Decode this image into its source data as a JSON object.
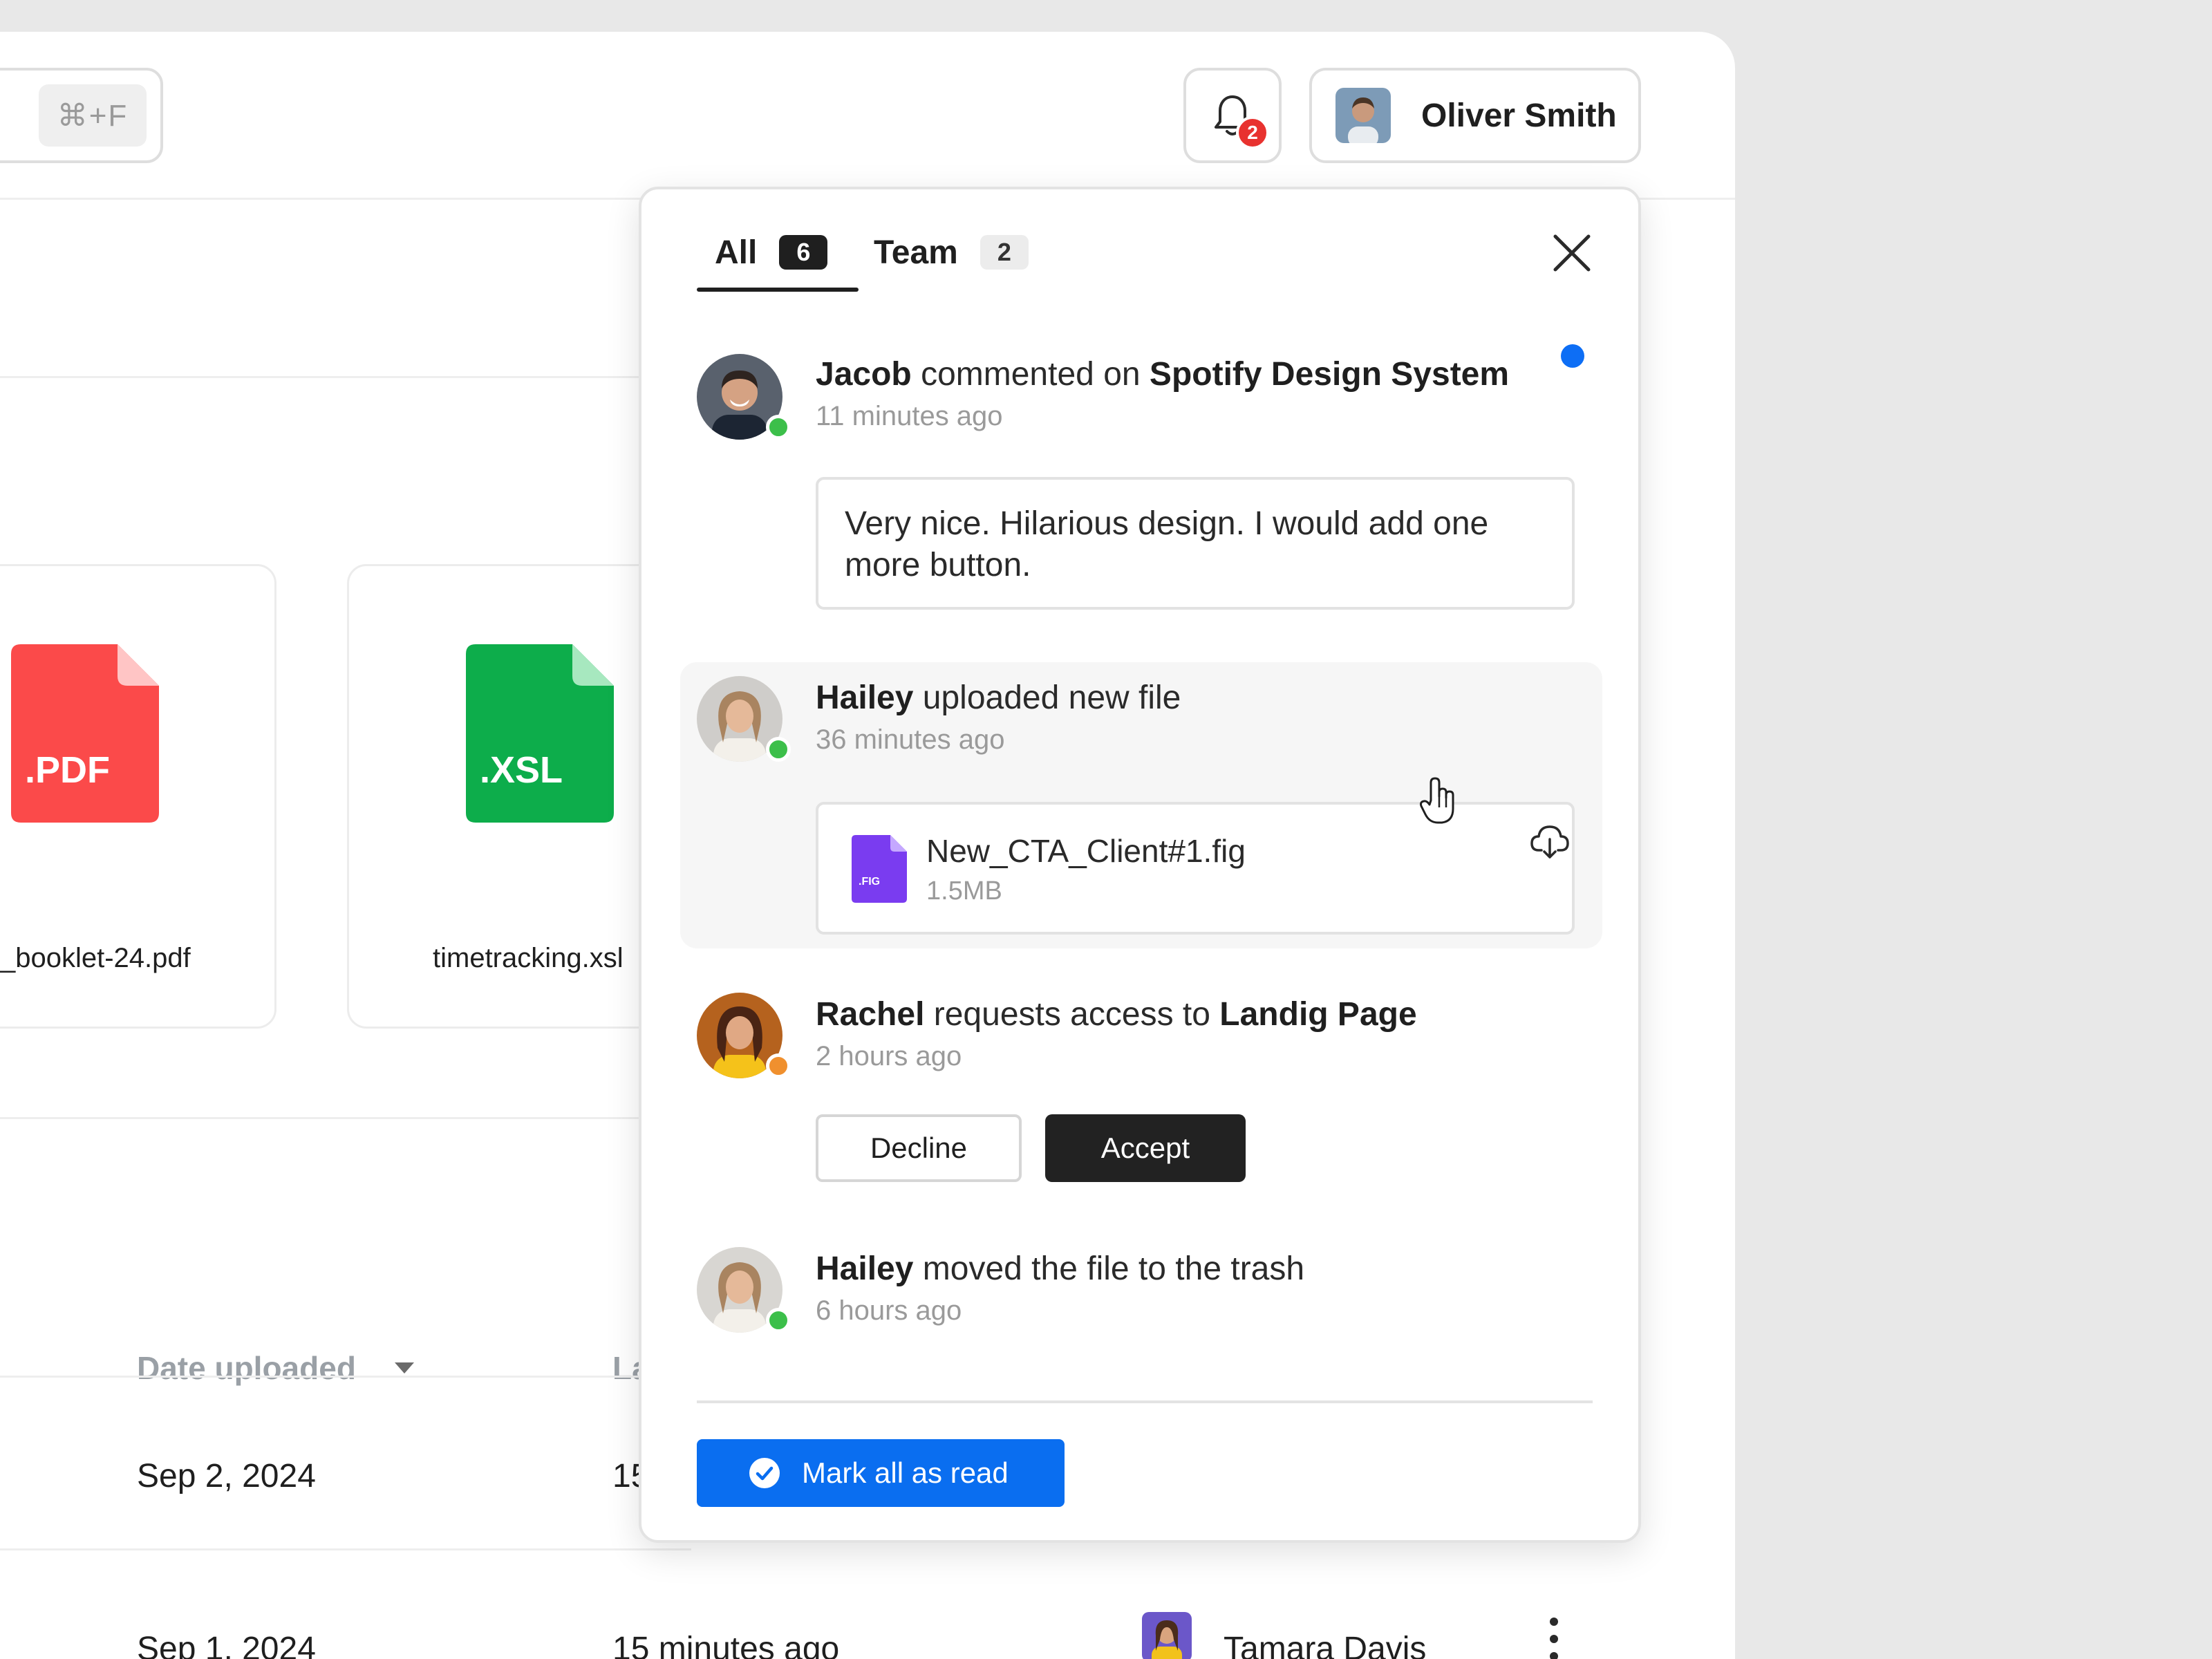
{
  "search": {
    "shortcut": "⌘+F"
  },
  "header": {
    "notification_count": "2",
    "user_name": "Oliver Smith"
  },
  "files": [
    {
      "name": "_booklet-24.pdf",
      "ext": ".PDF",
      "color": "#fb4a4a"
    },
    {
      "name": "timetracking.xsl",
      "ext": ".XSL",
      "color": "#0dad4b"
    }
  ],
  "table": {
    "headers": {
      "date_uploaded": "Date uploaded",
      "last": "La"
    },
    "rows": [
      {
        "date": "Sep 2, 2024",
        "last": "15"
      },
      {
        "date": "Sep 1, 2024",
        "last": "15 minutes ago",
        "owner": "Tamara Davis"
      }
    ]
  },
  "panel": {
    "tabs": [
      {
        "label": "All",
        "count": "6"
      },
      {
        "label": "Team",
        "count": "2"
      }
    ],
    "notifications": [
      {
        "actor": "Jacob",
        "action": " commented on ",
        "target": "Spotify Design System",
        "time": "11 minutes ago",
        "comment": "Very nice. Hilarious design. I would add one more button.",
        "status_color": "#3cbf4a",
        "unread": true
      },
      {
        "actor": "Hailey",
        "action": " uploaded new file",
        "time": "36 minutes ago",
        "file": {
          "name": "New_CTA_Client#1.fig",
          "size": "1.5MB",
          "ext": ".FIG"
        },
        "status_color": "#3cbf4a"
      },
      {
        "actor": "Rachel",
        "action": " requests access to ",
        "target": "Landig Page",
        "time": "2 hours ago",
        "decline_label": "Decline",
        "accept_label": "Accept",
        "status_color": "#f0902e"
      },
      {
        "actor": "Hailey",
        "action": " moved the file to the trash",
        "time": "6 hours ago",
        "status_color": "#3cbf4a"
      }
    ],
    "mark_all_label": "Mark all as read"
  },
  "colors": {
    "accent": "#0a6ef0",
    "unread_dot": "#0d6ef5",
    "badge_red": "#e8322f"
  }
}
